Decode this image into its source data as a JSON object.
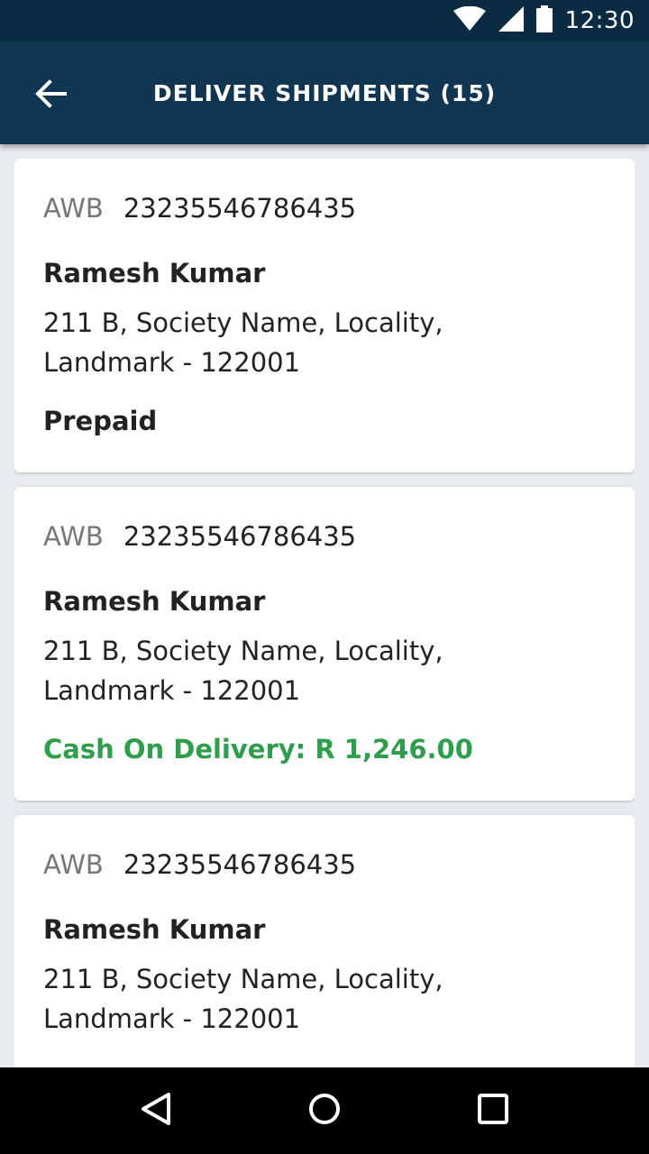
{
  "status_bar": {
    "time": "12:30",
    "icons": [
      "wifi-icon",
      "signal-icon",
      "battery-icon"
    ]
  },
  "app_bar": {
    "title": "DELIVER SHIPMENTS (15)",
    "back_icon": "back-arrow-icon"
  },
  "shipments": [
    {
      "awb_label": "AWB",
      "awb_number": "23235546786435",
      "name": "Ramesh Kumar",
      "address_line1": "211 B, Society Name, Locality,",
      "address_line2": "Landmark - 122001",
      "payment": "Prepaid"
    },
    {
      "awb_label": "AWB",
      "awb_number": "23235546786435",
      "name": "Ramesh Kumar",
      "address_line1": "211 B, Society Name, Locality,",
      "address_line2": "Landmark - 122001",
      "payment": "Cash On Delivery: R 1,246.00"
    },
    {
      "awb_label": "AWB",
      "awb_number": "23235546786435",
      "name": "Ramesh Kumar",
      "address_line1": "211 B, Society Name, Locality,",
      "address_line2": "Landmark - 122001",
      "payment": ""
    }
  ],
  "nav_bar": {
    "buttons": [
      "back-triangle-icon",
      "home-circle-icon",
      "recents-square-icon"
    ]
  },
  "colors": {
    "status_bar": "#0b2b42",
    "app_bar": "#113652",
    "cod_green": "#2e9e4c",
    "background": "#e8ebee"
  }
}
